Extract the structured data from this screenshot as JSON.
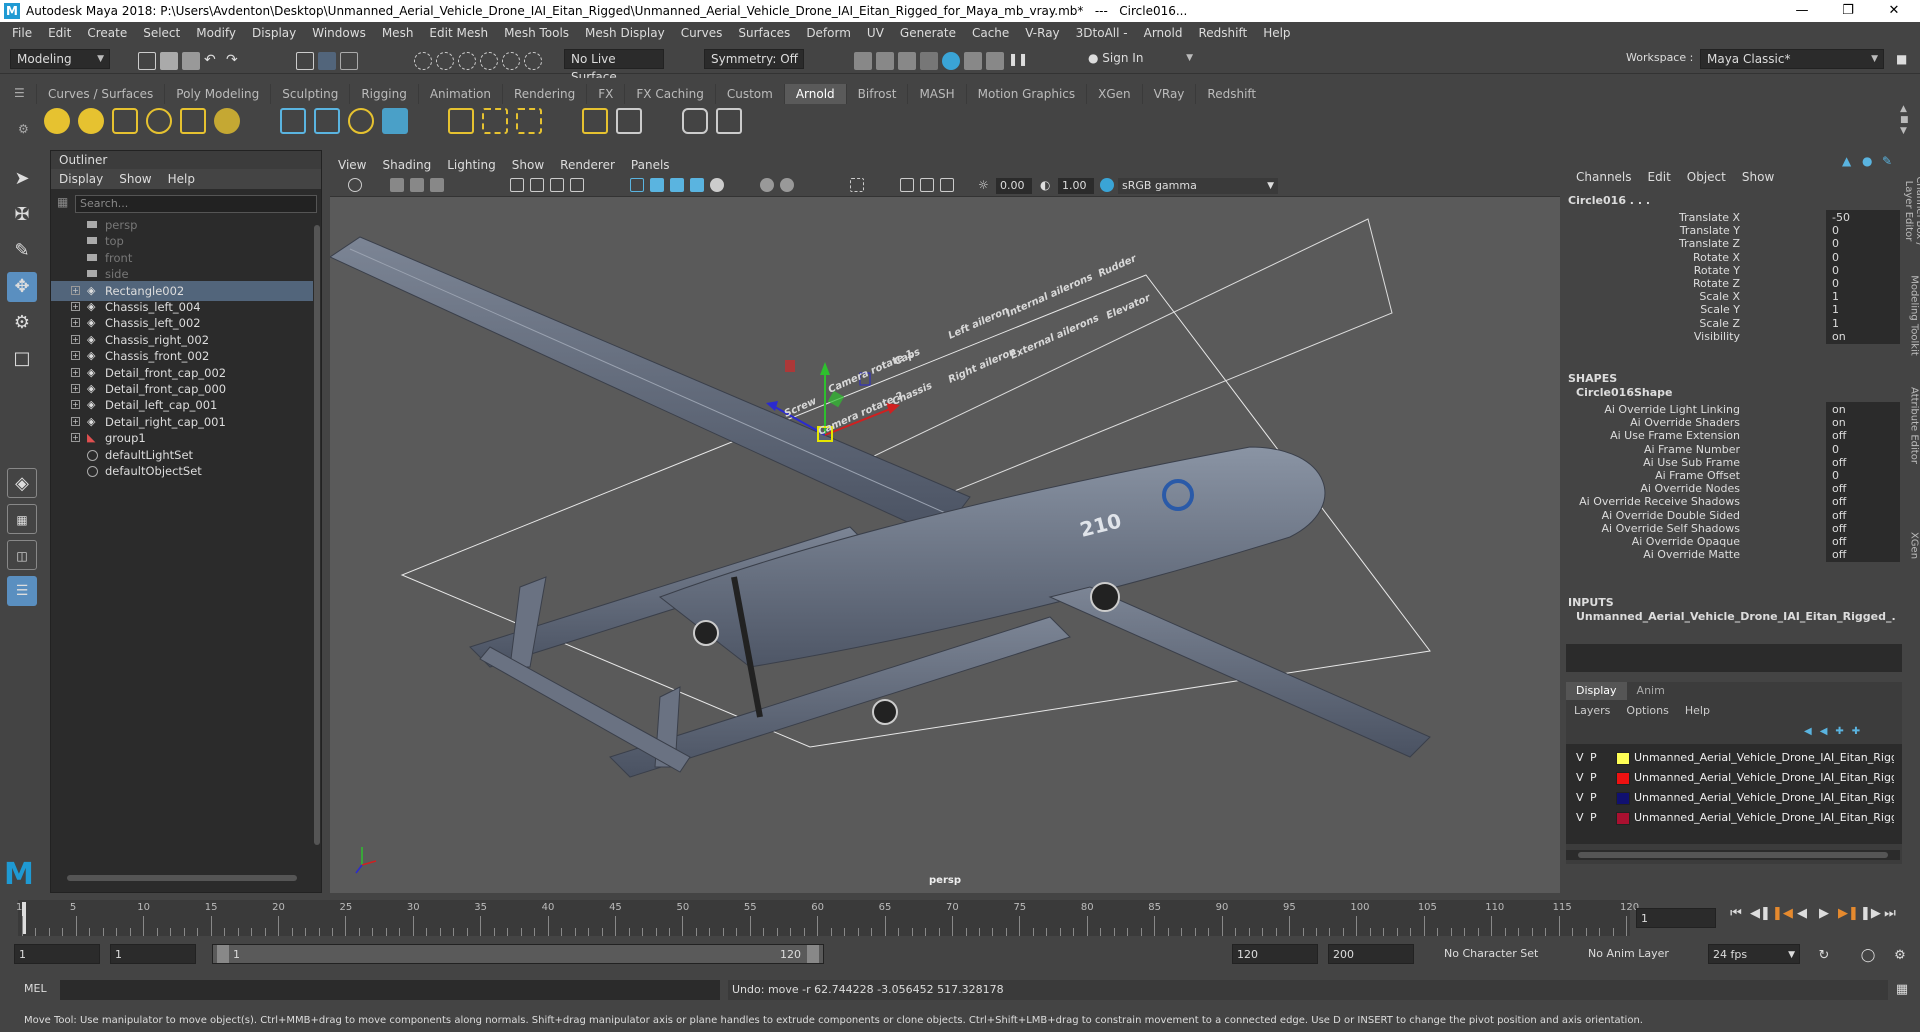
{
  "window": {
    "title": "Autodesk Maya 2018: P:\\Users\\Avdenton\\Desktop\\Unmanned_Aerial_Vehicle_Drone_IAI_Eitan_Rigged\\Unmanned_Aerial_Vehicle_Drone_IAI_Eitan_Rigged_for_Maya_mb_vray.mb*   ---   Circle016...",
    "logo": "M"
  },
  "menu": [
    "File",
    "Edit",
    "Create",
    "Select",
    "Modify",
    "Display",
    "Windows",
    "Mesh",
    "Edit Mesh",
    "Mesh Tools",
    "Mesh Display",
    "Curves",
    "Surfaces",
    "Deform",
    "UV",
    "Generate",
    "Cache",
    "V-Ray",
    "3DtoAll -",
    "Arnold",
    "Redshift",
    "Help"
  ],
  "toolbar": {
    "mode": "Modeling",
    "live_surface": "No Live Surface",
    "symmetry": "Symmetry: Off",
    "sign_in": "Sign In",
    "workspace_label": "Workspace :",
    "workspace": "Maya Classic*"
  },
  "shelf_tabs": [
    "Curves / Surfaces",
    "Poly Modeling",
    "Sculpting",
    "Rigging",
    "Animation",
    "Rendering",
    "FX",
    "FX Caching",
    "Custom",
    "Arnold",
    "Bifrost",
    "MASH",
    "Motion Graphics",
    "XGen",
    "VRay",
    "Redshift"
  ],
  "active_shelf": "Arnold",
  "outliner": {
    "title": "Outliner",
    "menu": [
      "Display",
      "Show",
      "Help"
    ],
    "search_placeholder": "Search...",
    "items": [
      {
        "label": "persp",
        "dim": true,
        "exp": false,
        "icon": "camera"
      },
      {
        "label": "top",
        "dim": true,
        "exp": false,
        "icon": "camera"
      },
      {
        "label": "front",
        "dim": true,
        "exp": false,
        "icon": "camera"
      },
      {
        "label": "side",
        "dim": true,
        "exp": false,
        "icon": "camera"
      },
      {
        "label": "Rectangle002",
        "sel": true,
        "exp": true,
        "icon": "transform"
      },
      {
        "label": "Chassis_left_004",
        "exp": true,
        "icon": "transform"
      },
      {
        "label": "Chassis_left_002",
        "exp": true,
        "icon": "transform"
      },
      {
        "label": "Chassis_right_002",
        "exp": true,
        "icon": "transform"
      },
      {
        "label": "Chassis_front_002",
        "exp": true,
        "icon": "transform"
      },
      {
        "label": "Detail_front_cap_002",
        "exp": true,
        "icon": "transform"
      },
      {
        "label": "Detail_front_cap_000",
        "exp": true,
        "icon": "transform"
      },
      {
        "label": "Detail_left_cap_001",
        "exp": true,
        "icon": "transform"
      },
      {
        "label": "Detail_right_cap_001",
        "exp": true,
        "icon": "transform"
      },
      {
        "label": "group1",
        "exp": true,
        "icon": "group"
      },
      {
        "label": "defaultLightSet",
        "exp": false,
        "icon": "set"
      },
      {
        "label": "defaultObjectSet",
        "exp": false,
        "icon": "set"
      }
    ]
  },
  "viewport": {
    "menu": [
      "View",
      "Shading",
      "Lighting",
      "Show",
      "Renderer",
      "Panels"
    ],
    "exposure": "0.00",
    "gamma": "1.00",
    "color_space": "sRGB gamma",
    "camera": "persp",
    "rig_labels": [
      "Rudder",
      "Elevator",
      "Internal ailerons",
      "External ailerons",
      "Left aileron",
      "Right aileron",
      "Caps",
      "Chassis",
      "Camera rotate 1",
      "Camera rotate 2",
      "Screw"
    ],
    "decal": "210"
  },
  "channel_box": {
    "menu": [
      "Channels",
      "Edit",
      "Object",
      "Show"
    ],
    "object": "Circle016 . . .",
    "attrs": [
      {
        "n": "Translate X",
        "v": "-50"
      },
      {
        "n": "Translate Y",
        "v": "0"
      },
      {
        "n": "Translate Z",
        "v": "0"
      },
      {
        "n": "Rotate X",
        "v": "0"
      },
      {
        "n": "Rotate Y",
        "v": "0"
      },
      {
        "n": "Rotate Z",
        "v": "0"
      },
      {
        "n": "Scale X",
        "v": "1"
      },
      {
        "n": "Scale Y",
        "v": "1"
      },
      {
        "n": "Scale Z",
        "v": "1"
      },
      {
        "n": "Visibility",
        "v": "on"
      }
    ],
    "shapes_title": "SHAPES",
    "shape_name": "Circle016Shape",
    "shape_attrs": [
      {
        "n": "Ai Override Light Linking",
        "v": "on"
      },
      {
        "n": "Ai Override Shaders",
        "v": "on"
      },
      {
        "n": "Ai Use Frame Extension",
        "v": "off"
      },
      {
        "n": "Ai Frame Number",
        "v": "0"
      },
      {
        "n": "Ai Use Sub Frame",
        "v": "off"
      },
      {
        "n": "Ai Frame Offset",
        "v": "0"
      },
      {
        "n": "Ai Override Nodes",
        "v": "off"
      },
      {
        "n": "Ai Override Receive Shadows",
        "v": "off"
      },
      {
        "n": "Ai Override Double Sided",
        "v": "off"
      },
      {
        "n": "Ai Override Self Shadows",
        "v": "off"
      },
      {
        "n": "Ai Override Opaque",
        "v": "off"
      },
      {
        "n": "Ai Override Matte",
        "v": "off"
      }
    ],
    "inputs_title": "INPUTS",
    "input_name": "Unmanned_Aerial_Vehicle_Drone_IAI_Eitan_Rigged_...",
    "layer_tabs": [
      "Display",
      "Anim"
    ],
    "layer_menu": [
      "Layers",
      "Options",
      "Help"
    ],
    "layers": [
      {
        "v": "V",
        "p": "P",
        "color": "#ffff55",
        "name": "Unmanned_Aerial_Vehicle_Drone_IAI_Eitan_Rigged_l"
      },
      {
        "v": "V",
        "p": "P",
        "color": "#ee1111",
        "name": "Unmanned_Aerial_Vehicle_Drone_IAI_Eitan_Rigged_("
      },
      {
        "v": "V",
        "p": "P",
        "color": "#101070",
        "name": "Unmanned_Aerial_Vehicle_Drone_IAI_Eitan_Rigged_l"
      },
      {
        "v": "V",
        "p": "P",
        "color": "#aa1030",
        "name": "Unmanned_Aerial_Vehicle_Drone_IAI_Eitan_Rigged_("
      }
    ]
  },
  "side_tabs": [
    "Channel Box / Layer Editor",
    "Modeling Toolkit",
    "Attribute Editor",
    "XGen"
  ],
  "timeline": {
    "ticks": [
      1,
      5,
      10,
      15,
      20,
      25,
      30,
      35,
      40,
      45,
      50,
      55,
      60,
      65,
      70,
      75,
      80,
      85,
      90,
      95,
      100,
      105,
      110,
      115,
      120
    ],
    "current_frame": "1"
  },
  "range": {
    "start": "1",
    "start2": "1",
    "slider_start": "1",
    "slider_end": "120",
    "end": "120",
    "end2": "200",
    "character_set": "No Character Set",
    "anim_layer": "No Anim Layer",
    "fps": "24 fps"
  },
  "cmd": {
    "label": "MEL",
    "result": "Undo: move -r 62.744228 -3.056452 517.328178"
  },
  "help": "Move Tool: Use manipulator to move object(s). Ctrl+MMB+drag to move components along normals. Shift+drag manipulator axis or plane handles to extrude components or clone objects. Ctrl+Shift+LMB+drag to constrain movement to a connected edge. Use D or INSERT to change the pivot position and axis orientation."
}
